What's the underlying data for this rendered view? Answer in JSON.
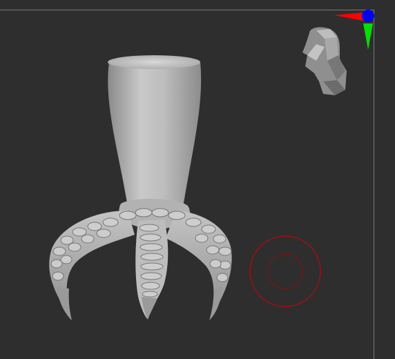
{
  "viewport": {
    "background": "#2e2e2e",
    "frame_color": "#7a7a7a"
  },
  "model": {
    "icon": "claw-foot-sculpt",
    "color": "#b5b5b5"
  },
  "gizmo": {
    "icon": "orientation-head-gizmo",
    "axis_x_color": "#ff0000",
    "axis_y_color": "#00e000",
    "axis_z_color": "#0000ff"
  },
  "brush_cursor": {
    "icon": "brush-radius-cursor",
    "color": "#a01010"
  }
}
